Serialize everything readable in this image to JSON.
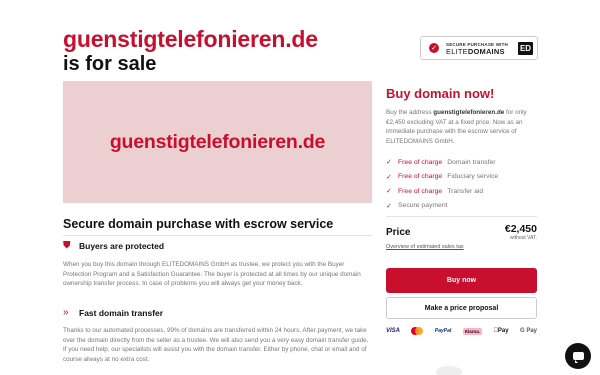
{
  "header": {
    "domain": "guenstigtelefonieren.de",
    "subtitle": "is for sale"
  },
  "badge": {
    "line1": "SECURE PURCHASE WITH",
    "brand_light": "ELITE",
    "brand_bold": "DOMAINS",
    "logo": "ED"
  },
  "hero": {
    "domain": "guenstigtelefonieren.de"
  },
  "secure": {
    "title": "Secure domain purchase with escrow service",
    "buyers": {
      "title": "Buyers are protected",
      "text": "When you buy this domain through ELITEDOMAINS GmbH as trustee, we protect you with the Buyer Protection Program and a Satisfaction Guarantee. The buyer is protected at all times by our unique domain ownership transfer process. In case of problems you will always get your money back."
    },
    "transfer": {
      "title": "Fast domain transfer",
      "text": "Thanks to our automated processes, 99% of domains are transferred within 24 hours. After payment, we take over the domain directly from the seller as a trustee. We will also send you a very easy domain transfer guide. If you need help, our specialists will assist you with the domain transfer. Either by phone, chat or email and of course always at no extra cost."
    }
  },
  "sidebar": {
    "title": "Buy domain now!",
    "desc_before": "Buy the address ",
    "desc_domain": "guenstigtelefonieren.de",
    "desc_after": " for only €2,450 excluding VAT at a fixed price. Now as an immediate purchase with the escrow service of ELITEDOMAINS GmbH.",
    "features": [
      {
        "free": "Free of charge",
        "label": "Domain transfer"
      },
      {
        "free": "Free of charge",
        "label": "Fiduciary service"
      },
      {
        "free": "Free of charge",
        "label": "Transfer aid"
      },
      {
        "free": "",
        "label": "Secure payment"
      }
    ],
    "price_label": "Price",
    "price": "€2,450",
    "vat_note": "without VAT.",
    "overview_link": "Overview of estimated sales tax",
    "buy_button": "Buy now",
    "offer_button": "Make a price proposal",
    "payments": [
      "VISA",
      "PayPal",
      "Klarna.",
      "Pay",
      "G Pay"
    ]
  },
  "colors": {
    "accent": "#c8102e",
    "hero_bg": "#ebcfd1"
  }
}
